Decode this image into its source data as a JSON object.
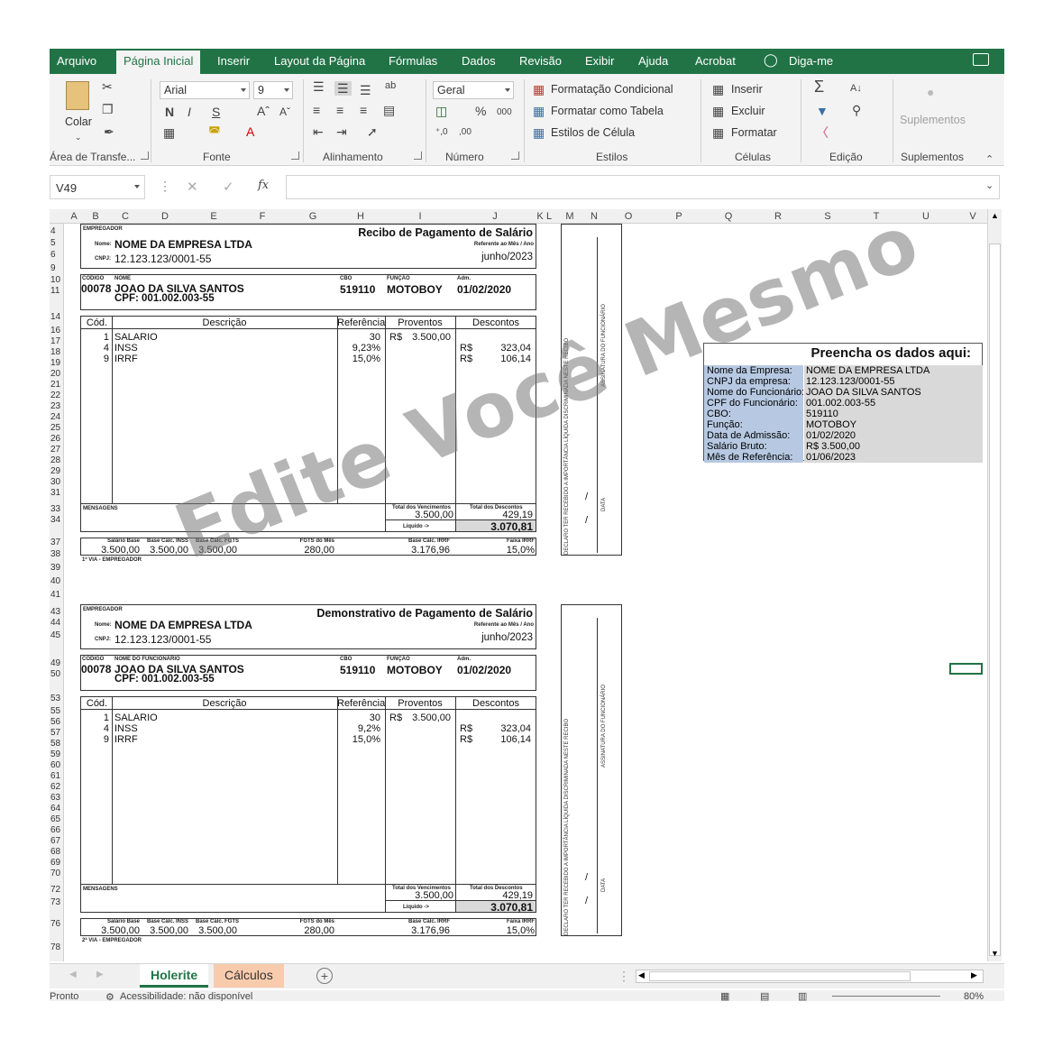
{
  "tabs": [
    "Arquivo",
    "Página Inicial",
    "Inserir",
    "Layout da Página",
    "Fórmulas",
    "Dados",
    "Revisão",
    "Exibir",
    "Ajuda",
    "Acrobat",
    "Diga-me"
  ],
  "ribbon": {
    "colar": "Colar",
    "font_name": "Arial",
    "font_size": "9",
    "number_format": "Geral",
    "percent": "%",
    "thousand": "000",
    "dec_inc": "⁺,0",
    "dec_dec": ",00",
    "formatacao_condicional": "Formatação Condicional",
    "formatar_tabela": "Formatar como Tabela",
    "estilos_celula": "Estilos de Célula",
    "inserir": "Inserir",
    "excluir": "Excluir",
    "formatar": "Formatar",
    "suplementos_btn": "Suplementos",
    "groups": {
      "clipboard": "Área de Transfe...",
      "fonte": "Fonte",
      "alinhamento": "Alinhamento",
      "numero": "Número",
      "estilos": "Estilos",
      "celulas": "Células",
      "edicao": "Edição",
      "suplementos": "Suplementos"
    }
  },
  "formula_bar": {
    "name_box": "V49",
    "fx": "fx",
    "cancel": "✕",
    "enter": "✓"
  },
  "columns": [
    "A",
    "B",
    "C",
    "D",
    "E",
    "F",
    "G",
    "H",
    "I",
    "J",
    "K",
    "L",
    "M",
    "N",
    "O",
    "P",
    "Q",
    "R",
    "S",
    "T",
    "U",
    "V"
  ],
  "rows": [
    "4",
    "5",
    "6",
    "9",
    "10",
    "11",
    "14",
    "16",
    "17",
    "18",
    "19",
    "20",
    "21",
    "22",
    "23",
    "24",
    "25",
    "26",
    "27",
    "28",
    "29",
    "30",
    "31",
    "33",
    "34",
    "37",
    "38",
    "39",
    "40",
    "41",
    "43",
    "44",
    "45",
    "49",
    "50",
    "53",
    "55",
    "56",
    "57",
    "58",
    "59",
    "60",
    "61",
    "62",
    "63",
    "64",
    "65",
    "66",
    "67",
    "68",
    "69",
    "70",
    "72",
    "73",
    "76",
    "78"
  ],
  "receipt1": {
    "employer_label": "EMPREGADOR",
    "title": "Recibo de Pagamento de Salário",
    "name_label": "Nome:",
    "company": "NOME DA EMPRESA LTDA",
    "cnpj_label": "CNPJ:",
    "cnpj": "12.123.123/0001-55",
    "ref_label": "Referente ao Mês / Ano",
    "month": "junho/2023",
    "code_label": "CÓDIGO",
    "emp_name_label": "NOME",
    "cbo_label": "CBO",
    "func_label": "FUNÇÃO",
    "adm_label": "Adm.",
    "code": "00078",
    "employee": "JOAO DA SILVA SANTOS",
    "cpf": "CPF: 001.002.003-55",
    "cbo": "519110",
    "funcao": "MOTOBOY",
    "admissao": "01/02/2020",
    "headers": [
      "Cód.",
      "Descrição",
      "Referência",
      "Proventos",
      "Descontos"
    ],
    "items": [
      {
        "cod": "1",
        "desc": "SALARIO",
        "ref": "30",
        "prov_cur": "R$",
        "prov": "3.500,00",
        "desc_cur": "",
        "descv": ""
      },
      {
        "cod": "4",
        "desc": "INSS",
        "ref": "9,23%",
        "prov_cur": "",
        "prov": "",
        "desc_cur": "R$",
        "descv": "323,04"
      },
      {
        "cod": "9",
        "desc": "IRRF",
        "ref": "15,0%",
        "prov_cur": "",
        "prov": "",
        "desc_cur": "R$",
        "descv": "106,14"
      }
    ],
    "messages_label": "MENSAGENS",
    "total_venc_label": "Total dos Vencimentos",
    "total_venc": "3.500,00",
    "total_desc_label": "Total dos Descontos",
    "total_desc": "429,19",
    "liquido_label": "Líquido ->",
    "liquido": "3.070,81",
    "footer_labels": [
      "Salário Base",
      "Base Cálc. INSS",
      "Base Cálc. FGTS",
      "FGTS do Mês",
      "Base Cálc. IRRF",
      "Faixa IRRF"
    ],
    "footer_values": [
      "3.500,00",
      "3.500,00",
      "3.500,00",
      "280,00",
      "3.176,96",
      "15,0%"
    ],
    "via": "1ª VIA - EMPREGADOR",
    "strip_declaro": "DECLARO TER RECEBIDO A IMPORTÂNCIA LÍQUIDA DISCRIMINADA NESTE RECIBO",
    "strip_assinatura": "ASSINATURA DO FUNCIONÁRIO",
    "strip_data": "DATA",
    "slash": "/"
  },
  "receipt2": {
    "employer_label": "EMPREGADOR",
    "title": "Demonstrativo de Pagamento de Salário",
    "name_label": "Nome:",
    "company": "NOME DA EMPRESA LTDA",
    "cnpj_label": "CNPJ:",
    "cnpj": "12.123.123/0001-55",
    "ref_label": "Referente ao Mês / Ano",
    "month": "junho/2023",
    "code_label": "CÓDIGO",
    "emp_name_label": "NOME DO FUNCIONÁRIO",
    "cbo_label": "CBO",
    "func_label": "FUNÇÃO",
    "adm_label": "Adm.",
    "code": "00078",
    "employee": "JOAO DA SILVA SANTOS",
    "cpf": "CPF: 001.002.003-55",
    "cbo": "519110",
    "funcao": "MOTOBOY",
    "admissao": "01/02/2020",
    "headers": [
      "Cód.",
      "Descrição",
      "Referência",
      "Proventos",
      "Descontos"
    ],
    "items": [
      {
        "cod": "1",
        "desc": "SALARIO",
        "ref": "30",
        "prov_cur": "R$",
        "prov": "3.500,00",
        "desc_cur": "",
        "descv": ""
      },
      {
        "cod": "4",
        "desc": "INSS",
        "ref": "9,2%",
        "prov_cur": "",
        "prov": "",
        "desc_cur": "R$",
        "descv": "323,04"
      },
      {
        "cod": "9",
        "desc": "IRRF",
        "ref": "15,0%",
        "prov_cur": "",
        "prov": "",
        "desc_cur": "R$",
        "descv": "106,14"
      }
    ],
    "messages_label": "MENSAGENS",
    "total_venc_label": "Total dos Vencimentos",
    "total_venc": "3.500,00",
    "total_desc_label": "Total dos Descontos",
    "total_desc": "429,19",
    "liquido_label": "Líquido ->",
    "liquido": "3.070,81",
    "footer_labels": [
      "Salário Base",
      "Base Cálc. INSS",
      "Base Cálc. FGTS",
      "FGTS do Mês",
      "Base Cálc. IRRF",
      "Faixa IRRF"
    ],
    "footer_values": [
      "3.500,00",
      "3.500,00",
      "3.500,00",
      "280,00",
      "3.176,96",
      "15,0%"
    ],
    "via": "2ª VIA - EMPREGADOR",
    "strip_declaro": "DECLARO TER RECEBIDO A IMPORTÂNCIA LÍQUIDA DISCRIMINADA NESTE RECIBO",
    "strip_assinatura": "ASSINATURA DO FUNCIONÁRIO",
    "strip_data": "DATA",
    "slash": "/"
  },
  "panel": {
    "title": "Preencha os dados aqui:",
    "rows": [
      {
        "label": "Nome da Empresa:",
        "value": "NOME DA EMPRESA LTDA"
      },
      {
        "label": "CNPJ da empresa:",
        "value": "12.123.123/0001-55"
      },
      {
        "label": "Nome do Funcionário:",
        "value": "JOAO DA SILVA SANTOS"
      },
      {
        "label": "CPF do Funcionário:",
        "value": "001.002.003-55"
      },
      {
        "label": "CBO:",
        "value": "519110"
      },
      {
        "label": "Função:",
        "value": "MOTOBOY"
      },
      {
        "label": "Data de Admissão:",
        "value": "01/02/2020"
      },
      {
        "label": "Salário Bruto:",
        "value": "R$ 3.500,00"
      },
      {
        "label": "Mês de Referência:",
        "value": "01/06/2023"
      }
    ]
  },
  "watermark": "Edite Você Mesmo",
  "sheet_tabs": [
    "Holerite",
    "Cálculos"
  ],
  "add_sheet": "+",
  "status": {
    "ready": "Pronto",
    "accessibility": "Acessibilidade: não disponível",
    "zoom": "80%"
  }
}
